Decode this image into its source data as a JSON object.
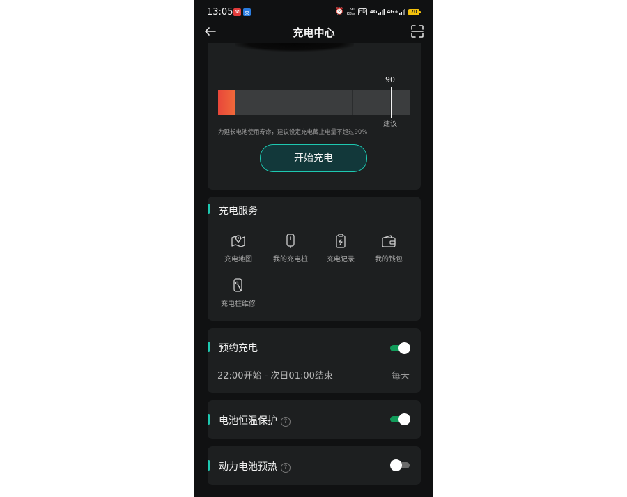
{
  "status_bar": {
    "time": "13:05",
    "net_speed_value": "1.90",
    "net_speed_unit": "KB/s",
    "hd_badge": "HD",
    "signal_1": "4G",
    "signal_2": "4G+",
    "battery_level": "70"
  },
  "header": {
    "title": "充电中心",
    "back_icon": "arrow-left-icon",
    "scan_icon": "scan-icon"
  },
  "charge_limit": {
    "current_level_percent": 9,
    "limit_percent": 90,
    "limit_label": "90",
    "limit_caption": "建议",
    "hint": "为延长电池使用寿命，建议设定充电截止电量不超过90%",
    "start_button": "开始充电",
    "fill_color": "#e8473a",
    "accent_color": "#1ec8b0"
  },
  "services": {
    "title": "充电服务",
    "items": [
      {
        "label": "充电地图",
        "icon": "map-pin-icon"
      },
      {
        "label": "我的充电桩",
        "icon": "charging-pile-icon"
      },
      {
        "label": "充电记录",
        "icon": "charge-record-icon"
      },
      {
        "label": "我的钱包",
        "icon": "wallet-icon"
      },
      {
        "label": "充电桩维修",
        "icon": "repair-icon"
      }
    ]
  },
  "schedule": {
    "title": "预约充电",
    "enabled": true,
    "time_range": "22:00开始 - 次日01:00结束",
    "repeat": "每天"
  },
  "thermal": {
    "title": "电池恒温保护",
    "enabled": true
  },
  "preheat": {
    "title": "动力电池预热",
    "enabled": false
  },
  "toggle_on_color": "#119b5a"
}
